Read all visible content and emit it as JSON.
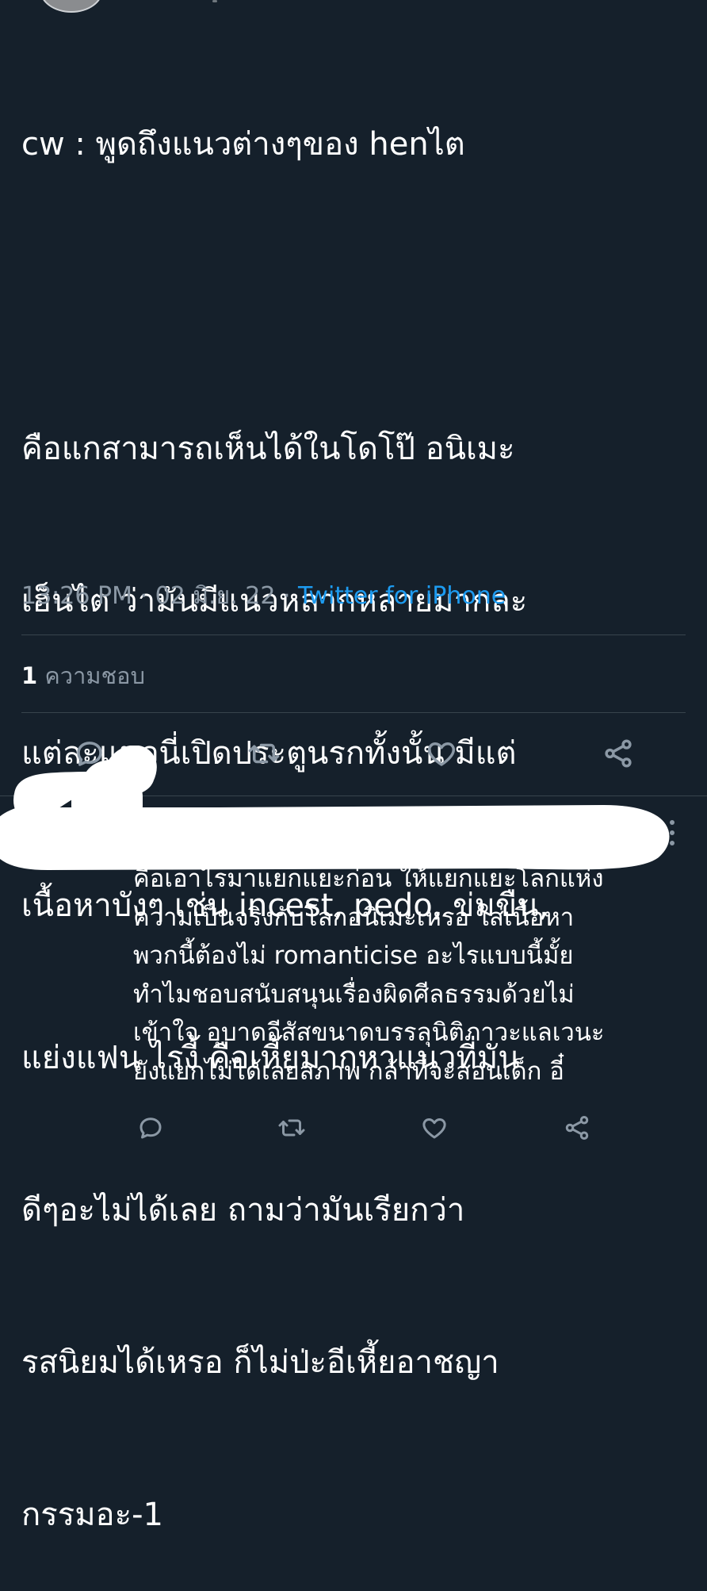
{
  "tweet": {
    "lines": [
      "cw : พูดถึงแนวต่างๆของ henไต",
      "",
      "คือแกสามารถเห็นได้ในโดโป๊ อนิเมะ",
      "เฮ็นไต ว่ามันมีแนวหลากหลายมากละ",
      "แต่ละแนวนี่เปิดประตูนรกทั้งนั้น มีแต่",
      "เนื้อหาบังๆ เช่น incest, pedo, ข่มขืน,",
      "แย่งแฟน ไรงี้ คือเหี้ยมากหาแนวที่มัน",
      "ดีๆอะไม่ได้เลย ถามว่ามันเรียกว่า",
      "รสนิยมได้เหรอ ก็ไม่ป่ะอีเหี้ยอาชญา",
      "กรรมอะ-1"
    ],
    "time": "13:26 PM",
    "separator": " · ",
    "date": "02 มิ.ย. 22",
    "source": "Twitter for iPhone",
    "likes_count": "1",
    "likes_label": " ความชอบ"
  },
  "icons": {
    "reply": "reply-icon",
    "retweet": "retweet-icon",
    "like": "heart-icon",
    "share": "share-icon",
    "more": "more-icon"
  },
  "reply": {
    "lines": [
      "คือเอาไรมาแยกแยะก่อน ให้แยกแยะโลกแห่ง",
      "ความเป็นจริงกับโลกอนิเมะเหรอ ใส่เนื้อหา",
      "พวกนี้ต้องไม่ romanticise อะไรแบบนี้มั้ย",
      "ทำไมชอบสนับสนุนเรื่องผิดศีลธรรมด้วยไม่",
      "เข้าใจ อุบาดอีสัสขนาดบรรลุนิติภาวะแลเวนะ",
      "ยังแยกไม่ได้เลยสภาพ กล้าที่จะสอนเด็ก อี๋"
    ]
  },
  "colors": {
    "background": "#15202b",
    "text": "#ffffff",
    "muted": "#8b98a5",
    "link": "#1d9bf0",
    "divider": "#38444d"
  }
}
